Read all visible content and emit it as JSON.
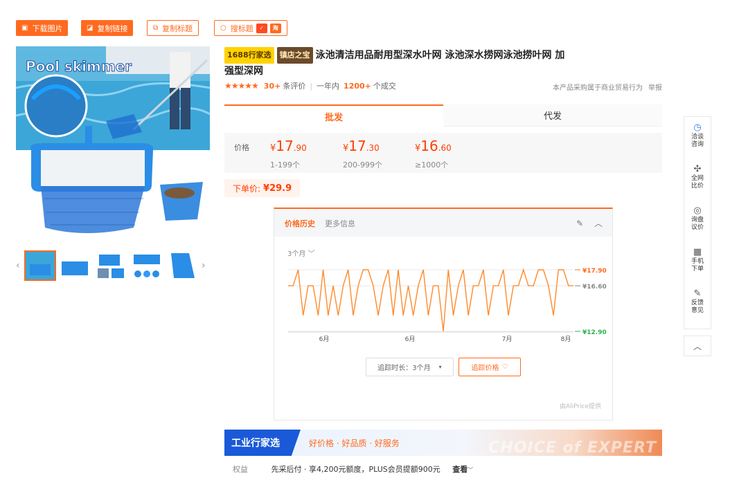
{
  "toolbar": {
    "download": "下载图片",
    "copy_link": "复制链接",
    "copy_title": "复制标题",
    "search_title": "搜标题"
  },
  "product": {
    "tag1": "1688行家选",
    "tag2": "镇店之宝",
    "title_line1": "泳池清洁用品耐用型深水叶网 泳池深水捞网泳池捞叶网 加",
    "title_line2": "强型深网",
    "reviews_count": "30+",
    "reviews_label": "条评价",
    "year_label": "一年内",
    "sold_count": "1200+",
    "sold_label": "个成交",
    "b2b_note": "本产品采购属于商业贸易行为",
    "report": "举报"
  },
  "tabs": {
    "wholesale": "批发",
    "dropship": "代发"
  },
  "pricing": {
    "label": "价格",
    "tiers": [
      {
        "int": "17",
        "dec": ".90",
        "qty": "1-199个"
      },
      {
        "int": "17",
        "dec": ".30",
        "qty": "200-999个"
      },
      {
        "int": "16",
        "dec": ".60",
        "qty": "≥1000个"
      }
    ],
    "yen": "¥",
    "order_label": "下单价:",
    "order_price": "¥29.9"
  },
  "history": {
    "tab_active": "价格历史",
    "tab_more": "更多信息",
    "range": "3个月",
    "duration_select": "追踪时长：3个月",
    "track_button": "追踪价格",
    "provider": "由AliPrice提供"
  },
  "chart_data": {
    "type": "line",
    "x_ticks": [
      "6月",
      "6月",
      "7月",
      "8月"
    ],
    "ylim": [
      12.9,
      17.9
    ],
    "labels": {
      "high": "¥17.90",
      "mid": "¥16.60",
      "low": "¥12.90"
    },
    "values": [
      16.6,
      16.6,
      17.9,
      14.2,
      16.6,
      16.6,
      14.2,
      17.9,
      14.2,
      16.6,
      14.2,
      16.6,
      17.9,
      14.2,
      16.6,
      17.9,
      17.9,
      16.6,
      14.2,
      16.6,
      17.9,
      14.2,
      17.9,
      14.2,
      16.6,
      14.2,
      16.6,
      17.9,
      14.2,
      16.6,
      16.6,
      12.9,
      17.9,
      14.2,
      16.6,
      17.9,
      14.2,
      16.6,
      16.6,
      17.9,
      14.2,
      16.6,
      16.6,
      17.9,
      14.2,
      16.6,
      16.6,
      17.9,
      16.6,
      16.6,
      17.9,
      17.9,
      16.6,
      14.2,
      17.9,
      17.9,
      16.6,
      16.6
    ],
    "colors": {
      "line": "#ff8a2a",
      "high": "#ff6a1f",
      "mid": "#888888",
      "low": "#2bb24c"
    }
  },
  "banner": {
    "name": "工业行家选",
    "slogan": "好价格 · 好品质 · 好服务",
    "choice": "CHOICE of EXPERT"
  },
  "benefit": {
    "label": "权益",
    "text": "先采后付 · 享4,200元额度，PLUS会员提额900元",
    "more": "查看"
  },
  "sidebar": {
    "items": [
      {
        "icon": "chat-icon",
        "l1": "洽谈",
        "l2": "咨询"
      },
      {
        "icon": "puzzle-icon",
        "l1": "全网",
        "l2": "比价"
      },
      {
        "icon": "target-icon",
        "l1": "询盘",
        "l2": "议价"
      },
      {
        "icon": "qrcode-icon",
        "l1": "手机",
        "l2": "下单"
      },
      {
        "icon": "edit-icon",
        "l1": "反馈",
        "l2": "意见"
      }
    ]
  },
  "image": {
    "caption": "Pool skimmer"
  }
}
